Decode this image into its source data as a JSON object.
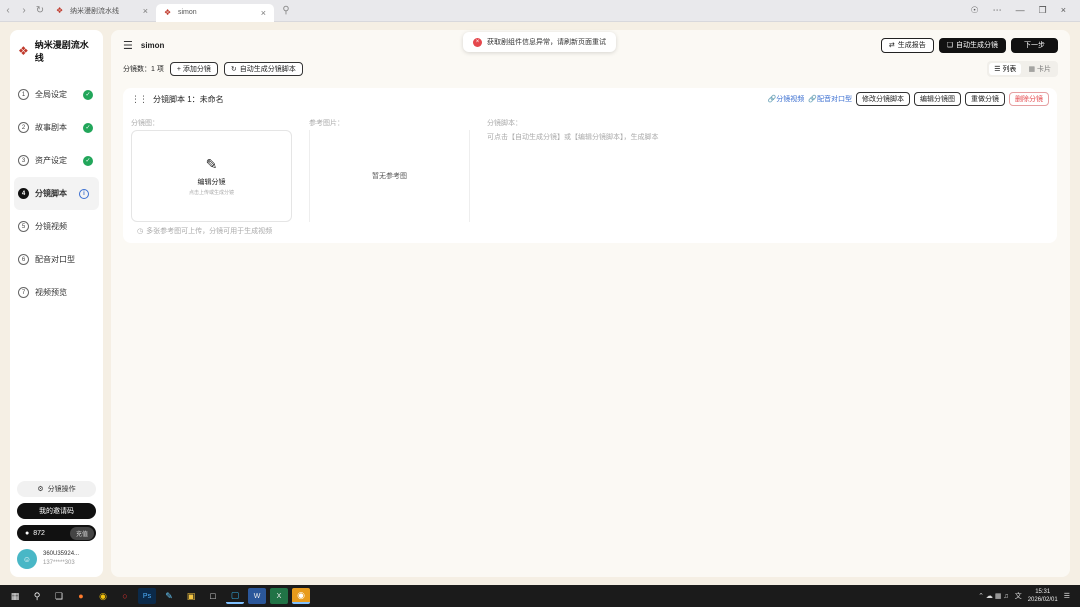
{
  "browser": {
    "tabs": [
      {
        "label": "纳米漫剧流水线",
        "active": false
      },
      {
        "label": "simon",
        "active": true
      }
    ]
  },
  "toast": {
    "message": "获取剧组件信息异常，请刷新页面重试"
  },
  "sidebar": {
    "brand": "纳米漫剧流水线",
    "steps": [
      {
        "num": "1",
        "label": "全局设定",
        "status": "done"
      },
      {
        "num": "2",
        "label": "故事剧本",
        "status": "done"
      },
      {
        "num": "3",
        "label": "资产设定",
        "status": "done"
      },
      {
        "num": "4",
        "label": "分镜脚本",
        "status": "active"
      },
      {
        "num": "5",
        "label": "分镜视频",
        "status": "pending"
      },
      {
        "num": "6",
        "label": "配音对口型",
        "status": "pending"
      },
      {
        "num": "7",
        "label": "视频预览",
        "status": "pending"
      }
    ],
    "shot_ops": "分镜操作",
    "redeem": "我的邀请码",
    "credits": "872",
    "recharge": "充值",
    "user_name": "360U35924...",
    "user_phone": "137*****303"
  },
  "topbar": {
    "title": "simon",
    "generate_report": "生成报告",
    "auto_generate": "自动生成分镜",
    "next": "下一步"
  },
  "toolbar": {
    "shot_count": "分镜数：1 项",
    "add_shot": "+ 添加分镜",
    "auto_script": "自动生成分镜脚本",
    "view_list": "列表",
    "view_card": "卡片"
  },
  "card": {
    "title": "分镜脚本 1：未命名",
    "gen_video": "分镜视频",
    "dub": "配音对口型",
    "edit_script": "修改分镜脚本",
    "edit_image": "编辑分镜图",
    "regen": "重做分镜",
    "delete": "删除分镜",
    "label_shot": "分镜图：",
    "label_ref": "参考图片：",
    "label_script": "分镜脚本：",
    "shot_title": "编辑分镜",
    "shot_sub": "点击上传或生成分镜",
    "ref_empty": "暂无参考图",
    "script_hint": "可点击【自动生成分镜】或【编辑分镜脚本】，生成脚本",
    "footer_hint": "多张参考图可上传，分镜可用于生成视频"
  },
  "taskbar": {
    "time": "15:31",
    "date": "2026/02/01"
  }
}
